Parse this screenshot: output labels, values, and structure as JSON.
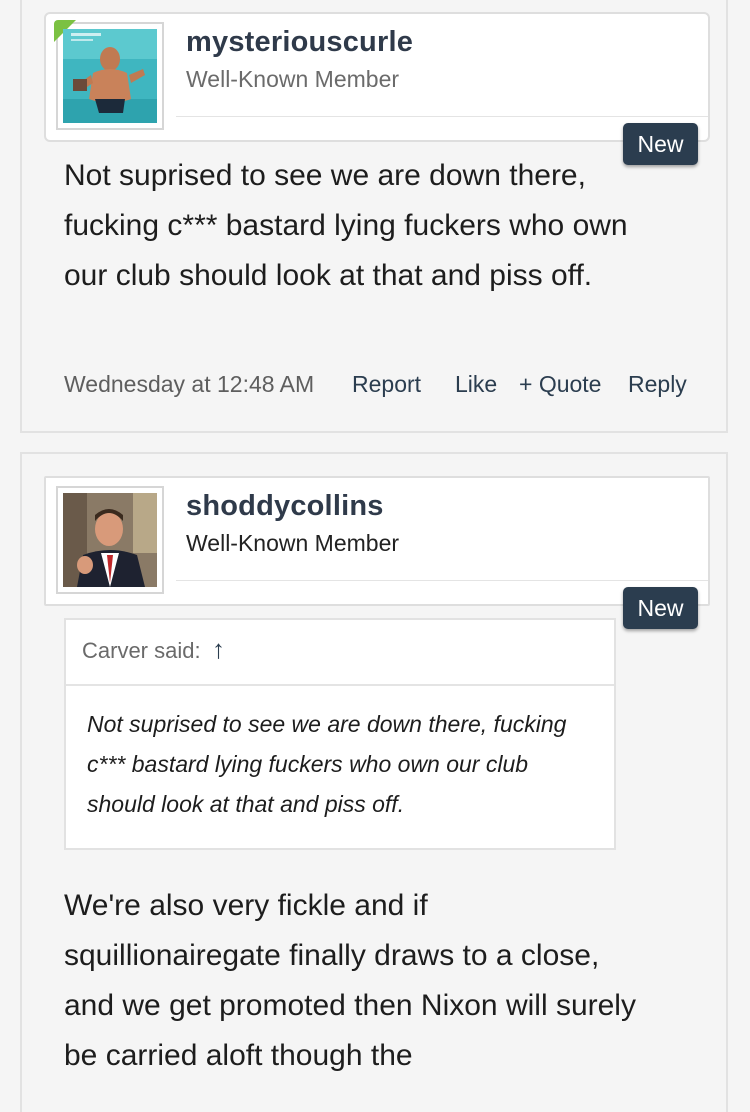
{
  "posts": [
    {
      "username": "mysteriouscurle",
      "user_title": "Well-Known Member",
      "badge": "New",
      "message": "Not suprised to see we are down there, fucking c*** bastard lying fuckers who own our club should look at that and piss off.",
      "date": "Wednesday at 12:48 AM",
      "actions": {
        "report": "Report",
        "like": "Like",
        "quote": "+ Quote",
        "reply": "Reply"
      }
    },
    {
      "username": "shoddycollins",
      "user_title": "Well-Known Member",
      "badge": "New",
      "quote": {
        "author": "Carver said:",
        "arrow": "↑",
        "text": "Not suprised to see we are down there, fucking c*** bastard lying fuckers who own our club should look at that and piss off."
      },
      "message": "We're also very fickle and if squillionairegate finally draws to a close, and we get promoted then Nixon will surely be carried aloft though the"
    }
  ],
  "colors": {
    "badge": "#2b3d4f",
    "username": "#2f3a4a",
    "leaf": "#7bc142"
  }
}
